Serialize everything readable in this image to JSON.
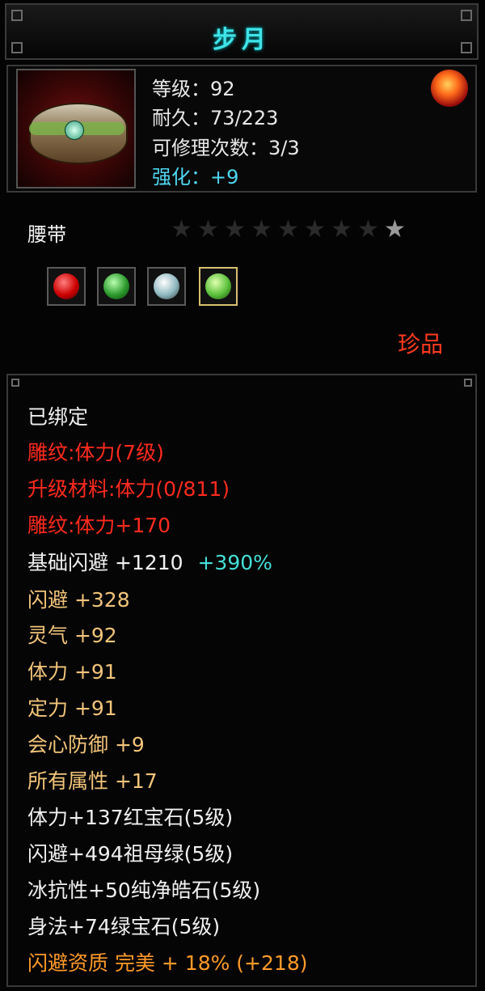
{
  "title": "步月",
  "header": {
    "level": "等级：92",
    "durability": "耐久：73/223",
    "repairs": "可修理次数：3/3",
    "refine": "强化：+9",
    "badge_icon": "dragon-emblem-icon",
    "item_icon": "waist-belt-icon"
  },
  "item_type": "腰带",
  "stars": {
    "total": 9,
    "lit": 1
  },
  "gems": [
    {
      "name": "ruby-gem-icon",
      "color": "#d81a1a"
    },
    {
      "name": "jade-ring-gem-icon",
      "color": "#3fae3a"
    },
    {
      "name": "diamond-gem-icon",
      "color": "#cfe8e8"
    },
    {
      "name": "emerald-gem-icon",
      "color": "#6fd04a"
    }
  ],
  "rarity": "珍品",
  "attributes": {
    "bound": "已绑定",
    "engrave1": "雕纹:体力(7级)",
    "upgrade_material": "升级材料:体力(0/811)",
    "engrave2": "雕纹:体力+170",
    "base_dodge": "基础闪避  +1210",
    "base_dodge_pct": "+390%",
    "dodge": "闪避  +328",
    "spirit": "灵气  +92",
    "stamina": "体力  +91",
    "focus": "定力  +91",
    "crit_def": "会心防御  +9",
    "all_attr": "所有属性  +17",
    "gem1": "体力+137红宝石(5级)",
    "gem2": "闪避+494祖母绿(5级)",
    "gem3": "冰抗性+50纯净皓石(5级)",
    "gem4": "身法+74绿宝石(5级)",
    "quality": "闪避资质  完美  + 18% (+218)"
  }
}
